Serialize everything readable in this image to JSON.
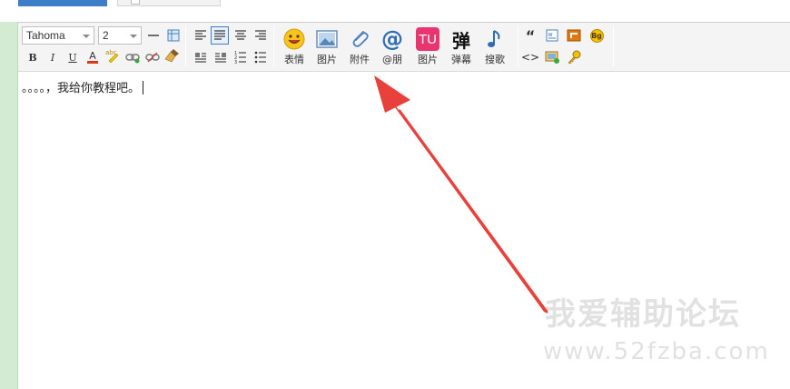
{
  "toolbar": {
    "font_family": "Tahoma",
    "font_size": "2",
    "big_buttons": [
      {
        "name": "emoji-button",
        "label": "表情",
        "icon": "smiley-icon"
      },
      {
        "name": "image-button",
        "label": "图片",
        "icon": "image-icon"
      },
      {
        "name": "attachment-button",
        "label": "附件",
        "icon": "paperclip-icon"
      },
      {
        "name": "mention-button",
        "label": "@朋",
        "icon": "at-icon"
      },
      {
        "name": "tu-image-button",
        "label": "图片",
        "icon": "tu-icon"
      },
      {
        "name": "danmaku-button",
        "label": "弹幕",
        "icon": "dan-icon"
      },
      {
        "name": "search-song-button",
        "label": "搜歌",
        "icon": "music-note-icon"
      }
    ],
    "tu_text": "TU",
    "dan_text": "弹",
    "at_text": "@",
    "quote_text": "“",
    "code_text": "<>",
    "bg_text": "Bg",
    "bold_text": "B",
    "italic_text": "I",
    "underline_text": "U",
    "color_text": "A",
    "abc_text": "abc"
  },
  "content": {
    "text": "。。。。，我给你教程吧。"
  },
  "watermark": {
    "title": "我爱辅助论坛",
    "url": "www.52fzba.com"
  },
  "colors": {
    "accent": "#3d7ec9",
    "arrow": "#e8413c",
    "side_strip": "#d2ebd2"
  }
}
